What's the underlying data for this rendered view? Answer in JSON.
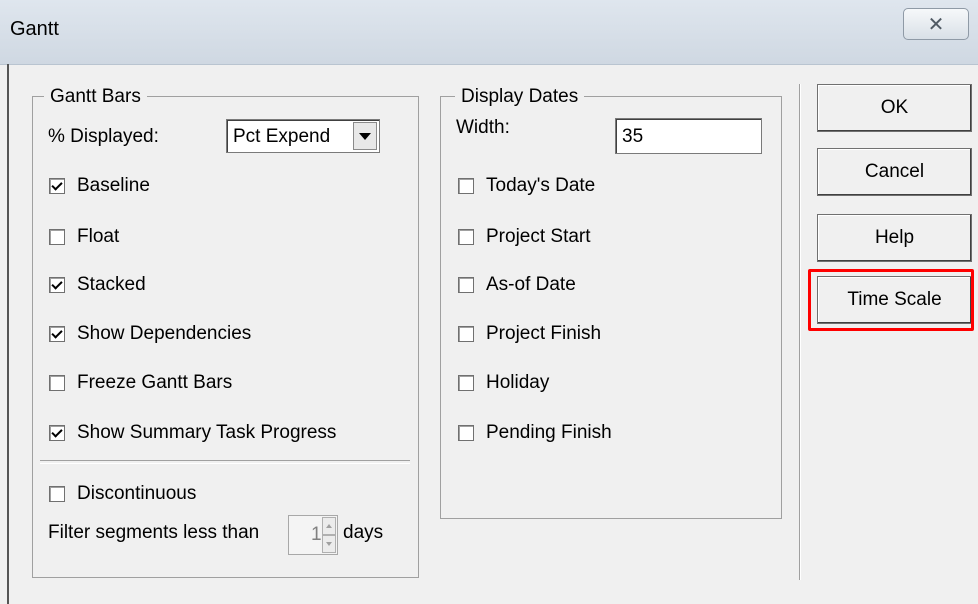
{
  "window": {
    "title": "Gantt",
    "close_icon": "close-x-icon"
  },
  "gantt_bars": {
    "legend": "Gantt Bars",
    "pct_label": "% Displayed:",
    "pct_value": "Pct Expend",
    "checkboxes": [
      {
        "label": "Baseline",
        "checked": true
      },
      {
        "label": "Float",
        "checked": false
      },
      {
        "label": "Stacked",
        "checked": true
      },
      {
        "label": "Show Dependencies",
        "checked": true
      },
      {
        "label": "Freeze Gantt Bars",
        "checked": false
      },
      {
        "label": "Show Summary Task Progress",
        "checked": true
      }
    ],
    "discontinuous": {
      "label": "Discontinuous",
      "checked": false
    },
    "filter_label": "Filter segments less than",
    "filter_value": "1",
    "filter_unit": "days"
  },
  "display_dates": {
    "legend": "Display Dates",
    "width_label": "Width:",
    "width_value": "35",
    "checkboxes": [
      {
        "label": "Today's Date",
        "checked": false
      },
      {
        "label": "Project Start",
        "checked": false
      },
      {
        "label": "As-of Date",
        "checked": false
      },
      {
        "label": "Project Finish",
        "checked": false
      },
      {
        "label": "Holiday",
        "checked": false
      },
      {
        "label": "Pending Finish",
        "checked": false
      }
    ]
  },
  "buttons": {
    "ok": "OK",
    "cancel": "Cancel",
    "help": "Help",
    "time_scale": "Time Scale"
  },
  "colors": {
    "highlight": "#ff0000",
    "dialog_bg": "#f0f0f0"
  }
}
